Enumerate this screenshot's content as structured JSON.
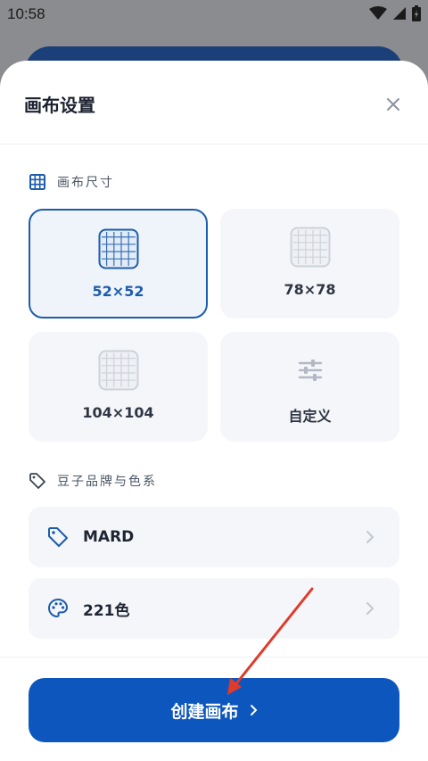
{
  "status_bar": {
    "time": "10:58"
  },
  "sheet": {
    "title": "画布设置",
    "canvas_size": {
      "section_label": "画布尺寸",
      "options": [
        {
          "label": "52×52",
          "selected": true
        },
        {
          "label": "78×78",
          "selected": false
        },
        {
          "label": "104×104",
          "selected": false
        },
        {
          "label": "自定义",
          "selected": false
        }
      ]
    },
    "bead_brand": {
      "section_label": "豆子品牌与色系",
      "brand": "MARD",
      "palette": "221色"
    },
    "create_button": {
      "label": "创建画布"
    }
  },
  "colors": {
    "accent": "#0d56bd",
    "selected_border": "#1c5cac",
    "card_bg": "#f4f6f9",
    "annotation_arrow": "#e03a2b"
  }
}
